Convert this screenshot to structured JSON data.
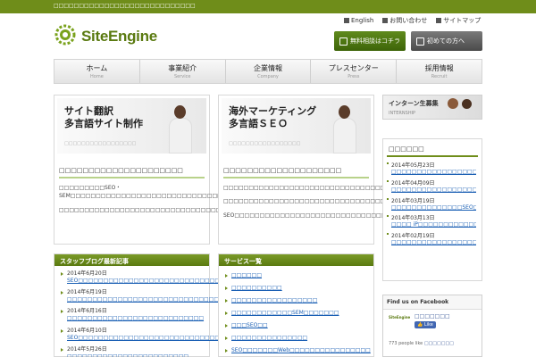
{
  "topbar": {
    "text": "□□□□□□□□□□□□□□□□□□□□□□□□□□□□"
  },
  "logo": {
    "text": "SiteEngine"
  },
  "utility": [
    {
      "label": "English"
    },
    {
      "label": "お問い合わせ"
    },
    {
      "label": "サイトマップ"
    }
  ],
  "cta": {
    "primary": "無料相談はコチラ",
    "secondary": "初めての方へ"
  },
  "nav": [
    {
      "label": "ホーム",
      "sub": "Home"
    },
    {
      "label": "事業紹介",
      "sub": "Service"
    },
    {
      "label": "企業情報",
      "sub": "Company"
    },
    {
      "label": "プレスセンター",
      "sub": "Press"
    },
    {
      "label": "採用情報",
      "sub": "Recruit"
    }
  ],
  "features": [
    {
      "banner_line1": "サイト翻訳",
      "banner_line2": "多言語サイト制作",
      "banner_sub": "□□□□□□□□□□□□□□□□□",
      "heading": "□□□□□□□□□□□□□□□□□□□□□",
      "text1": "□□□□□□□□□SEO・SEM□□□□□□□□□□□□□□□□□□□□□□□□□□□□□□□□□□□□□□□□□□□□□□□□□□□□□□□□□□□",
      "text2": "□□□□□□□□□□□□□□□□□□□□□□□□□□□□□□□□□□□□□□□□□□□□□□□□"
    },
    {
      "banner_line1": "海外マーケティング",
      "banner_line2": "多言語ＳＥＯ",
      "banner_sub": "□□□□□□□□□□□□□□□□□",
      "heading": "□□□□□□□□□□□□□□□□□□□□",
      "text1": "□□□□□□□□□□□□□□□□□□□□□□□□□□□□□□□□□□□□□□□□□□□□□□□□□□",
      "text2": "□□□□□□□□□□□□□□□□□□□□□□□□□□□□□□□□□",
      "text3": "SEO□□□□□□□□□□□□□□□□□□□□□□□□□□□□□□□□□□□□□□□□□□"
    }
  ],
  "internship": {
    "title": "インターン生募集",
    "sub": "INTERNSHIP"
  },
  "news": {
    "title": "□□□□□□",
    "items": [
      {
        "date": "2014年05月23日",
        "link": "□□□□□□□□□□□□□□□□□□□□□□□□□□"
      },
      {
        "date": "2014年04月09日",
        "link": "□□□□□□□□□□□□□□□□□□□□□□□□□□□□"
      },
      {
        "date": "2014年03月19日",
        "link": "□□□□□□□□□□□□□□SEO□□□□□□□□□□"
      },
      {
        "date": "2014年03月13日",
        "link": "□□□□ iP□□□□□□□□□□□□□□□□□□"
      },
      {
        "date": "2014年02月19日",
        "link": "□□□□□□□□□□□□□□□□□□□□□□□□"
      }
    ]
  },
  "blog": {
    "title": "スタッフブログ最新記事",
    "items": [
      {
        "date": "2014年6月20日",
        "link": "SEO□□□□□□□□□□□□□□□□□□□□□□□□□□□□□□□□"
      },
      {
        "date": "2014年6月19日",
        "link": "□□□□□□□□□□□□□□□□□□□□□□□□□□□□□□□□□□□□4.0□□□□□□□□□□"
      },
      {
        "date": "2014年6月16日",
        "link": "□□□□□□□□□□□□□□□□□□□□□□□□□□□"
      },
      {
        "date": "2014年6月10日",
        "link": "SEO□□□□□□□□□□□□□□□□□□□□□□□□□□□□□□□□"
      },
      {
        "date": "2014年5月26日",
        "link": "□□□□□□□□□□□□□□□□□□□□□□□□"
      }
    ]
  },
  "services": {
    "title": "サービス一覧",
    "items": [
      {
        "link": "□□□□□□"
      },
      {
        "link": "□□□□□□□□□□"
      },
      {
        "link": "□□□□□□□□□□□□□□□□□"
      },
      {
        "link": "□□□□□□□□□□□□SEM□□□□□□□"
      },
      {
        "link": "□□□SEO□□"
      },
      {
        "link": "□□□□□□□□□□□□□□□"
      },
      {
        "link": "SEO□□□□□□□Web□□□□□□□□□□□□□□□□"
      }
    ]
  },
  "facebook": {
    "header": "Find us on Facebook",
    "logo_text": "SiteEngine",
    "page_name": "□□□□□□□",
    "like": "Like",
    "count_prefix": "773 people like",
    "count_link": "□□□□□□□"
  },
  "colors": {
    "brand_green": "#6f8d1a",
    "link_blue": "#1a5fb4"
  }
}
